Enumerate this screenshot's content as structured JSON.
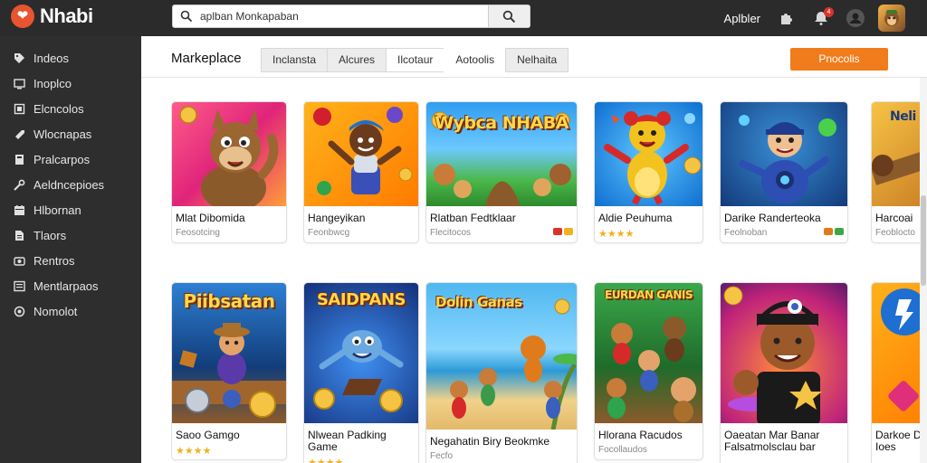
{
  "app": {
    "brand": "Nhabi",
    "colors": {
      "accent": "#f07c1b",
      "brand": "#e8542f",
      "topbar": "#2b2b2b",
      "sidebar": "#2e2e2e"
    }
  },
  "search": {
    "value": "aplban Monkapaban",
    "placeholder": ""
  },
  "topbar": {
    "user_label": "Aplbler",
    "notification_count": "4"
  },
  "sidebar": {
    "items": [
      {
        "label": "Indeos",
        "icon": "tag-icon"
      },
      {
        "label": "Inoplco",
        "icon": "monitor-icon"
      },
      {
        "label": "Elcncolos",
        "icon": "square-icon"
      },
      {
        "label": "Wlocnapas",
        "icon": "tag-icon"
      },
      {
        "label": "Pralcarpos",
        "icon": "bookmark-icon"
      },
      {
        "label": "Aeldncepioes",
        "icon": "wrench-icon"
      },
      {
        "label": "Hlbornan",
        "icon": "calendar-icon"
      },
      {
        "label": "Tlaors",
        "icon": "document-icon"
      },
      {
        "label": "Rentros",
        "icon": "camera-icon"
      },
      {
        "label": "Mentlarpaos",
        "icon": "list-icon"
      },
      {
        "label": "Nomolot",
        "icon": "settings-icon"
      }
    ]
  },
  "main": {
    "title": "Markeplace",
    "tabs": [
      {
        "label": "Inclansta"
      },
      {
        "label": "Alcures"
      },
      {
        "label": "Ilcotaur"
      },
      {
        "label": "Aotoolis"
      },
      {
        "label": "Nelhaita"
      }
    ],
    "action_button": "Pnocolis"
  },
  "cards": [
    {
      "title": "Mlat Dibomida",
      "meta": "Feosotcing",
      "rating": "",
      "thumb_title": ""
    },
    {
      "title": "Hangeyikan",
      "meta": "Feonbwcg",
      "rating": "",
      "thumb_title": ""
    },
    {
      "title": "Rlatban Fedtklaar",
      "meta": "Flecitocos",
      "rating": "",
      "thumb_title": "Wybca NHABA"
    },
    {
      "title": "Aldie Peuhuma",
      "meta": "",
      "rating": "★★★★",
      "thumb_title": ""
    },
    {
      "title": "Darike Randerteoka",
      "meta": "Feolnoban",
      "rating": "",
      "thumb_title": ""
    },
    {
      "title": "Harcoai",
      "meta": "Feoblocto",
      "rating": "",
      "thumb_title": "Neli"
    },
    {
      "title": "Saoo Gamgo",
      "meta": "",
      "rating": "★★★★",
      "thumb_title": "Piibsatan"
    },
    {
      "title": "Nlwean Padking Game",
      "meta": "",
      "rating": "★★★★",
      "thumb_title": "SAIDPANS"
    },
    {
      "title": "Negahatin Biry Beokmke",
      "meta": "Fecfo",
      "rating": "",
      "thumb_title": "Dolin Ganas"
    },
    {
      "title": "Hlorana Racudos",
      "meta": "Focollaudos",
      "rating": "",
      "thumb_title": "EURDAN GANIS"
    },
    {
      "title": "Oaeatan Mar Banar Falsatmolsclau bar",
      "meta": "",
      "rating": "",
      "thumb_title": ""
    },
    {
      "title": "Darkoe Dare Ioes",
      "meta": "",
      "rating": "",
      "thumb_title": ""
    }
  ]
}
